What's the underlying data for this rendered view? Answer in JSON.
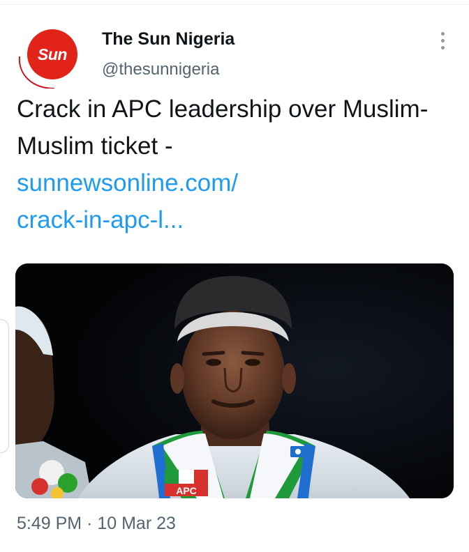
{
  "account": {
    "display_name": "The Sun Nigeria",
    "handle": "@thesunnigeria",
    "avatar_logo_text": "Sun",
    "avatar_color": "#e2231a"
  },
  "tweet": {
    "text": "Crack in APC leadership over Muslim-Muslim ticket -",
    "link_line_1": "sunnewsonline.com/",
    "link_line_2": "crack-in-apc-l...",
    "link_color": "#1d9bf0",
    "media_badge_text": "APC",
    "timestamp": "5:49 PM",
    "separator": "·",
    "date": "10 Mar 23"
  },
  "icons": {
    "more": "more-vertical-icon"
  }
}
